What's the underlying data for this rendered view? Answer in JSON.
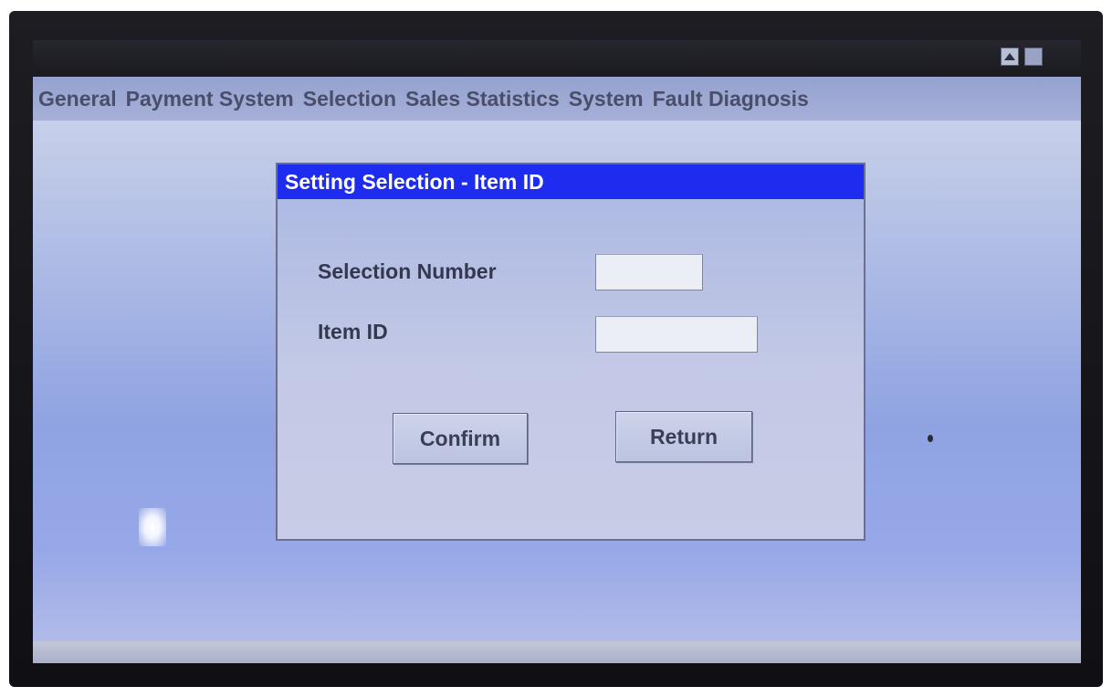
{
  "menu": {
    "items": [
      "General",
      "Payment System",
      "Selection",
      "Sales Statistics",
      "System",
      "Fault Diagnosis"
    ]
  },
  "titlebar": {
    "buttons": [
      "up-arrow-icon",
      "window-icon"
    ]
  },
  "dialog": {
    "title": "Setting Selection - Item ID",
    "fields": {
      "selection_number": {
        "label": "Selection Number",
        "value": ""
      },
      "item_id": {
        "label": "Item ID",
        "value": ""
      }
    },
    "buttons": {
      "confirm": "Confirm",
      "return": "Return"
    }
  },
  "colors": {
    "dialog_titlebar": "#1e2cf0",
    "screen_background": "#9aaae6"
  }
}
